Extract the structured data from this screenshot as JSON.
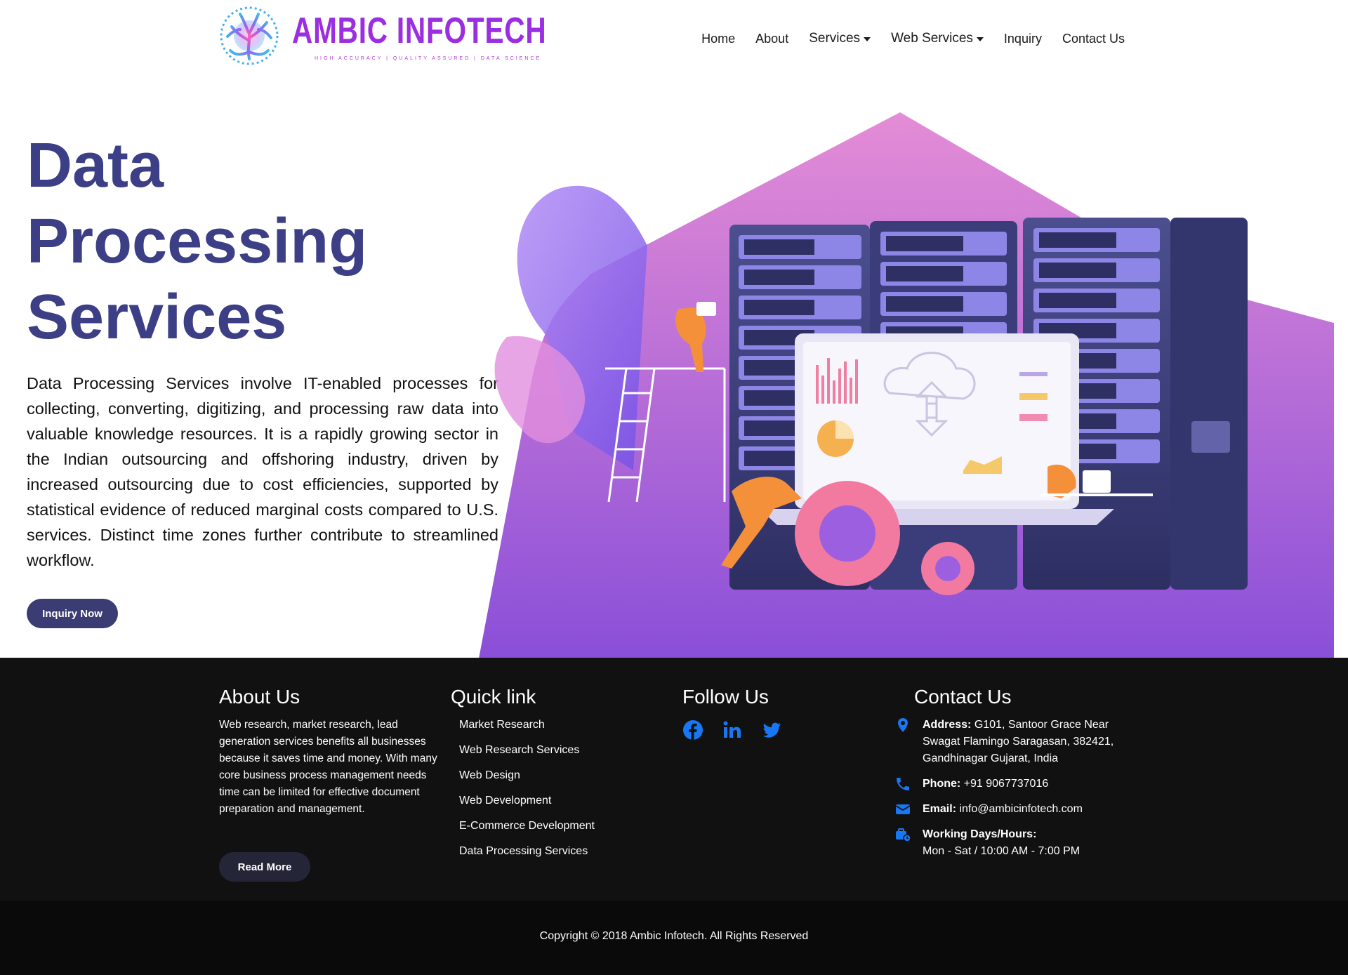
{
  "brand": {
    "name": "AMBIC INFOTECH",
    "tagline": "HIGH ACCURACY | QUALITY ASSURED | DATA SCIENCE"
  },
  "nav": {
    "items": [
      {
        "label": "Home",
        "dropdown": false
      },
      {
        "label": "About",
        "dropdown": false
      },
      {
        "label": "Services",
        "dropdown": true
      },
      {
        "label": "Web Services",
        "dropdown": true
      },
      {
        "label": "Inquiry",
        "dropdown": false
      },
      {
        "label": "Contact Us",
        "dropdown": false
      }
    ]
  },
  "hero": {
    "title_line1": "Data",
    "title_line2": "Processing",
    "title_line3": "Services",
    "description": "Data Processing Services involve IT-enabled processes for collecting, converting, digitizing, and processing raw data into valuable knowledge resources. It is a rapidly growing sector in the Indian outsourcing and offshoring industry, driven by increased outsourcing due to cost efficiencies, supported by statistical evidence of reduced marginal costs compared to U.S. services. Distinct time zones further contribute to streamlined workflow.",
    "button_label": "Inquiry Now"
  },
  "footer": {
    "about": {
      "heading": "About Us",
      "text": "Web research, market research, lead generation services benefits all businesses because it saves time and money. With many core business process management needs time can be limited for effective document preparation and management.",
      "button_label": "Read More"
    },
    "quick_links": {
      "heading": "Quick link",
      "items": [
        "Market Research",
        "Web Research Services",
        "Web Design",
        "Web Development",
        "E-Commerce Development",
        "Data Processing Services"
      ]
    },
    "follow": {
      "heading": "Follow Us",
      "icons": [
        "facebook-icon",
        "linkedin-icon",
        "twitter-icon"
      ],
      "accent": "#1877f2"
    },
    "contact": {
      "heading": "Contact Us",
      "address_label": "Address:",
      "address_value": "G101, Santoor Grace Near Swagat Flamingo Saragasan, 382421, Gandhinagar Gujarat, India",
      "phone_label": "Phone:",
      "phone_value": "+91 9067737016",
      "email_label": "Email:",
      "email_value": "info@ambicinfotech.com",
      "hours_label": "Working Days/Hours:",
      "hours_value": "Mon - Sat / 10:00 AM - 7:00 PM"
    },
    "copyright": "Copyright © 2018 Ambic Infotech. All Rights Reserved"
  },
  "colors": {
    "title": "#3d3f86",
    "button": "#3a3c73",
    "footer_bg": "#111111",
    "icon_blue": "#1877f2",
    "logo_purple": "#9a2ee0"
  }
}
